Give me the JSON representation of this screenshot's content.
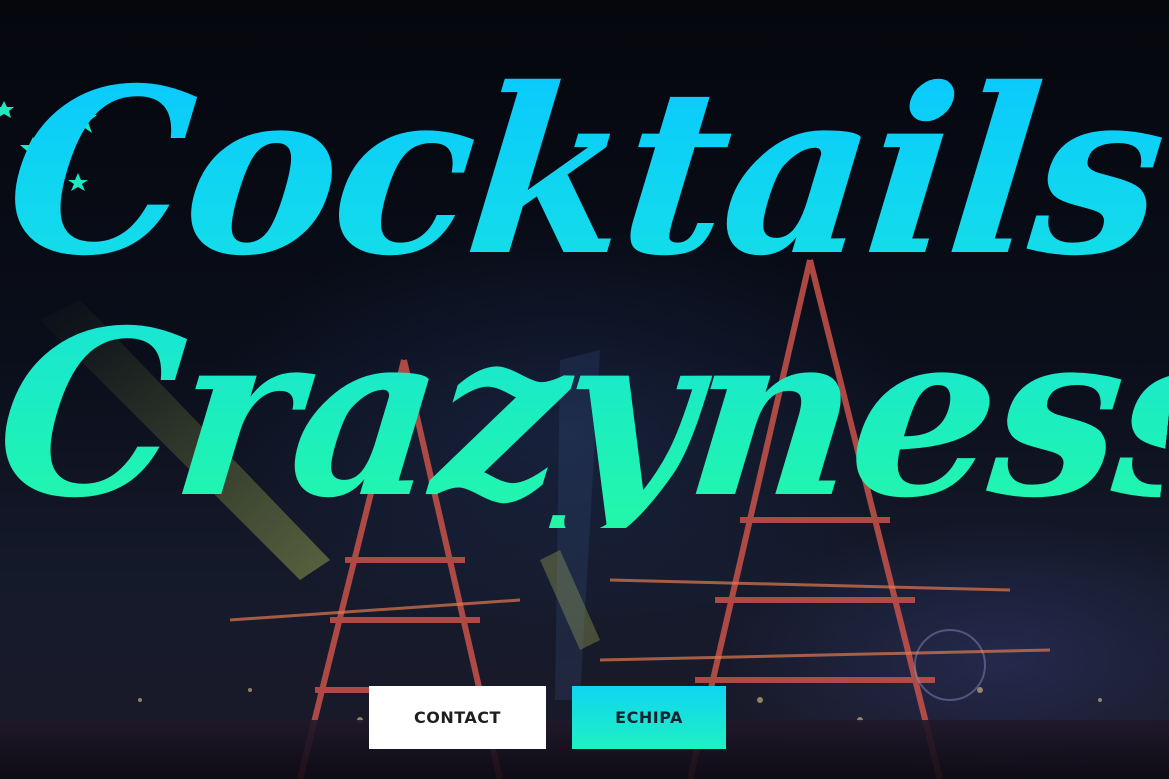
{
  "hero": {
    "title_line_1": "Cocktails",
    "title_line_2": "Crazyness",
    "background_scene": "night-festival-towers",
    "accent_gradient": [
      "#09c8ff",
      "#22f7a8"
    ]
  },
  "buttons": {
    "contact_label": "CONTACT",
    "echipa_label": "ECHIPA"
  },
  "decor": {
    "stars_icon": "stars-icon",
    "star_color": "#1fe8c0"
  }
}
